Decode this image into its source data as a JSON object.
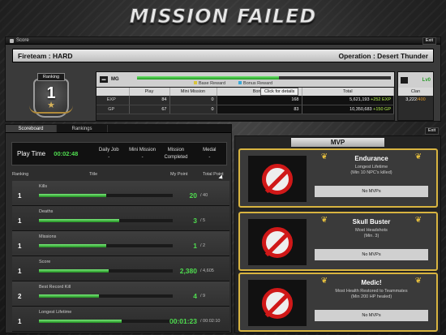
{
  "header": {
    "title": "MISSION FAILED"
  },
  "score_window": {
    "title": "Score",
    "exit_label": "Exit",
    "fireteam": "Fireteam : HARD",
    "operation": "Operation : Desert Thunder",
    "rank_label": "Ranking",
    "rank_value": "1",
    "weapon": {
      "label": "MG",
      "progress": 0.56,
      "level": "Lv0",
      "legend_base": "Base Reward",
      "legend_bonus": "Bonus Reward",
      "details_button": "Click for details"
    },
    "stats": {
      "headers": [
        "",
        "Play",
        "Mini Mission",
        "Bonus",
        "Total"
      ],
      "rows": [
        {
          "label": "EXP",
          "play": "84",
          "mini": "0",
          "bonus": "168",
          "total": "5,621,193",
          "delta": "+252 EXP"
        },
        {
          "label": "GP",
          "play": "67",
          "mini": "0",
          "bonus": "83",
          "total": "10,350,683",
          "delta": "+150 GP"
        }
      ]
    },
    "clan": {
      "header": "Clan",
      "value": "3,222",
      "sub": "/400"
    }
  },
  "scoreboard": {
    "tabs": [
      "Scoreboard",
      "Rankings"
    ],
    "play_time_label": "Play Time",
    "play_time_value": "00:02:48",
    "summary": [
      {
        "label": "Daily Job",
        "value": "-"
      },
      {
        "label": "Mini Mission",
        "value": "-"
      },
      {
        "label": "Mission",
        "value": "Completed"
      },
      {
        "label": "Medal",
        "value": "-"
      }
    ],
    "columns": {
      "ranking": "Ranking",
      "title": "Title",
      "my_point": "My Point",
      "total_point": "Total Point"
    },
    "rows": [
      {
        "rank": "1",
        "title": "Kills",
        "fill": 0.5,
        "mine": "20",
        "total": "/ 40"
      },
      {
        "rank": "1",
        "title": "Deaths",
        "fill": 0.6,
        "mine": "3",
        "total": "/ 5"
      },
      {
        "rank": "1",
        "title": "Missions",
        "fill": 0.5,
        "mine": "1",
        "total": "/ 2"
      },
      {
        "rank": "1",
        "title": "Score",
        "fill": 0.52,
        "mine": "2,380",
        "total": "/ 4,605"
      },
      {
        "rank": "2",
        "title": "Best Record Kill",
        "fill": 0.45,
        "mine": "4",
        "total": "/ 9"
      },
      {
        "rank": "1",
        "title": "Longest Lifetime",
        "fill": 0.62,
        "mine": "00:01:23",
        "total": "/ 00:02:10"
      }
    ]
  },
  "mvp": {
    "header": "MVP",
    "exit_label": "Exit",
    "cards": [
      {
        "title": "Endurance",
        "sub1": "Longest Lifetime",
        "sub2": "(Min 10 NPC's killed)",
        "none": "No MVPs"
      },
      {
        "title": "Skull Buster",
        "sub1": "Most Headshots",
        "sub2": "(Min. 3)",
        "none": "No MVPs"
      },
      {
        "title": "Medic!",
        "sub1": "Most Health Restored to Teammates",
        "sub2": "(Min 200 HP healed)",
        "none": "No MVPs"
      }
    ]
  },
  "colors": {
    "accent_green": "#4fdc4f",
    "gold": "#d8b440",
    "no_sign_red": "#d01818"
  }
}
